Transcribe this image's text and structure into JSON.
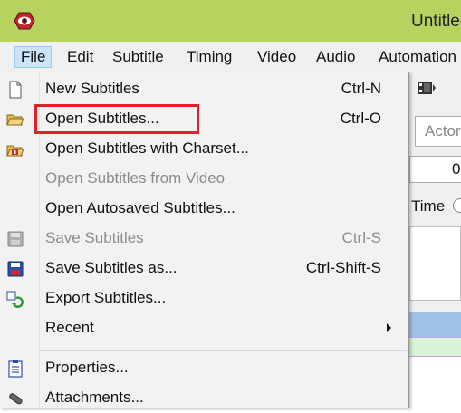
{
  "window": {
    "title": "Untitled"
  },
  "menubar": {
    "items": [
      "File",
      "Edit",
      "Subtitle",
      "Timing",
      "Video",
      "Audio",
      "Automation"
    ]
  },
  "background": {
    "actor_placeholder": "Actor",
    "time_value": "0",
    "time_label": "Time"
  },
  "file_menu": {
    "items": [
      {
        "label": "New Subtitles",
        "shortcut": "Ctrl-N",
        "enabled": true,
        "icon": "new-file-icon"
      },
      {
        "label": "Open Subtitles...",
        "shortcut": "Ctrl-O",
        "enabled": true,
        "icon": "open-folder-icon",
        "highlighted": true
      },
      {
        "label": "Open Subtitles with Charset...",
        "shortcut": "",
        "enabled": true,
        "icon": "open-charset-icon"
      },
      {
        "label": "Open Subtitles from Video",
        "shortcut": "",
        "enabled": false,
        "icon": ""
      },
      {
        "label": "Open Autosaved Subtitles...",
        "shortcut": "",
        "enabled": true,
        "icon": ""
      },
      {
        "label": "Save Subtitles",
        "shortcut": "Ctrl-S",
        "enabled": false,
        "icon": "save-icon"
      },
      {
        "label": "Save Subtitles as...",
        "shortcut": "Ctrl-Shift-S",
        "enabled": true,
        "icon": "save-as-icon"
      },
      {
        "label": "Export Subtitles...",
        "shortcut": "",
        "enabled": true,
        "icon": "export-icon"
      },
      {
        "label": "Recent",
        "shortcut": "",
        "enabled": true,
        "icon": "",
        "submenu": true
      },
      {
        "label": "Properties...",
        "shortcut": "",
        "enabled": true,
        "icon": "properties-icon"
      },
      {
        "label": "Attachments...",
        "shortcut": "",
        "enabled": true,
        "icon": "attachments-icon"
      }
    ]
  },
  "colors": {
    "titlebar": "#b6d35f",
    "highlight_border": "#e0202a",
    "menu_active": "#cce4f7"
  }
}
